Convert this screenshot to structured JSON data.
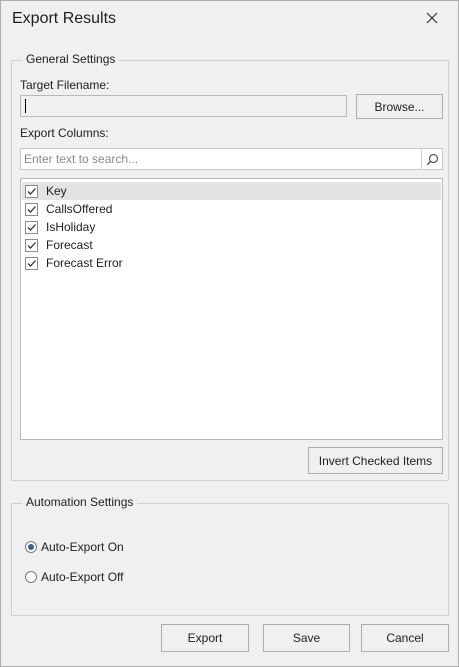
{
  "window": {
    "title": "Export Results"
  },
  "general": {
    "group_title": "General Settings",
    "filename_label": "Target Filename:",
    "filename_value": "",
    "browse_label": "Browse...",
    "columns_label": "Export Columns:",
    "search_placeholder": "Enter text to search...",
    "items": [
      {
        "label": "Key",
        "checked": true,
        "selected": true
      },
      {
        "label": "CallsOffered",
        "checked": true,
        "selected": false
      },
      {
        "label": "IsHoliday",
        "checked": true,
        "selected": false
      },
      {
        "label": "Forecast",
        "checked": true,
        "selected": false
      },
      {
        "label": "Forecast Error",
        "checked": true,
        "selected": false
      }
    ],
    "invert_label": "Invert Checked Items"
  },
  "automation": {
    "group_title": "Automation Settings",
    "options": [
      {
        "label": "Auto-Export On",
        "checked": true
      },
      {
        "label": "Auto-Export Off",
        "checked": false
      }
    ]
  },
  "footer": {
    "export_label": "Export",
    "save_label": "Save",
    "cancel_label": "Cancel"
  },
  "colors": {
    "accent": "#3f5c96",
    "selection": "#e3e3e3"
  },
  "icons": {
    "close": "close-icon",
    "search": "search-icon",
    "check": "check-icon"
  }
}
